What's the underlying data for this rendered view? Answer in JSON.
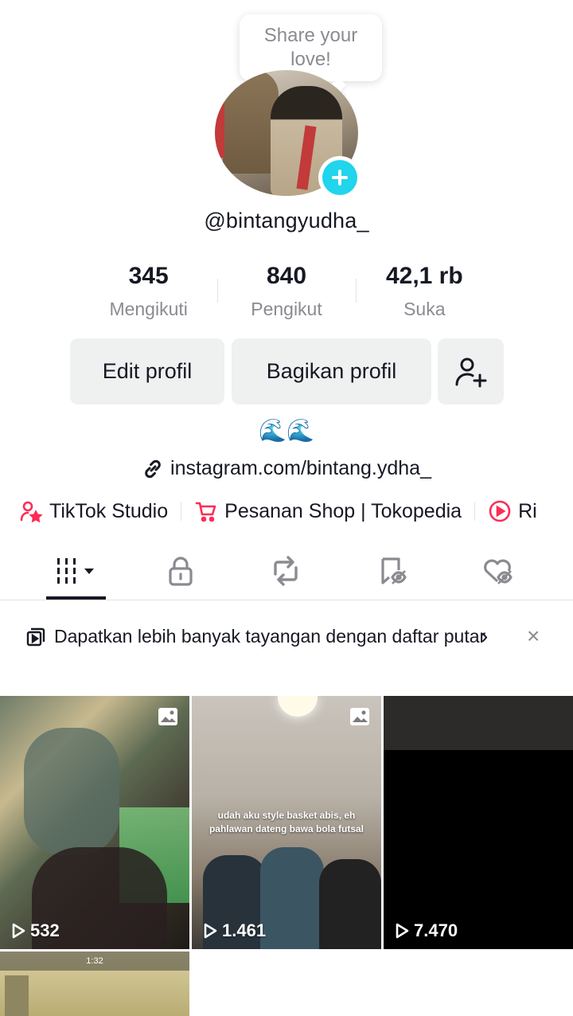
{
  "profile": {
    "bubble_text": "Share your love!",
    "username": "@bintangyudha_",
    "bio": "🌊🌊",
    "link": "instagram.com/bintang.ydha_"
  },
  "stats": [
    {
      "value": "345",
      "label": "Mengikuti"
    },
    {
      "value": "840",
      "label": "Pengikut"
    },
    {
      "value": "42,1 rb",
      "label": "Suka"
    }
  ],
  "buttons": {
    "edit": "Edit profil",
    "share": "Bagikan profil"
  },
  "shortcuts": [
    {
      "label": "TikTok Studio",
      "icon": "person-star-icon"
    },
    {
      "label": "Pesanan Shop | Tokopedia",
      "icon": "cart-icon"
    },
    {
      "label": "Ri",
      "icon": "play-circle-icon"
    }
  ],
  "tabs": [
    {
      "name": "videos",
      "icon": "grid-icon",
      "active": true
    },
    {
      "name": "private",
      "icon": "lock-icon"
    },
    {
      "name": "reposts",
      "icon": "repost-icon"
    },
    {
      "name": "favorites",
      "icon": "bookmark-icon"
    },
    {
      "name": "liked",
      "icon": "heart-hidden-icon"
    }
  ],
  "banner": {
    "text": "Dapatkan lebih banyak tayangan dengan daftar putar",
    "chevron": "›",
    "close": "×"
  },
  "videos": [
    {
      "views": "532",
      "type": "photo"
    },
    {
      "views": "1.461",
      "type": "photo",
      "caption": "udah aku style basket abis, eh pahlawan dateng bawa bola futsal"
    },
    {
      "views": "7.470",
      "type": "video"
    },
    {
      "views": "",
      "type": "video",
      "hud_time": "1:32"
    }
  ],
  "colors": {
    "accent_cyan": "#20d5ec",
    "brand_red": "#fe2c55",
    "text_primary": "#161823",
    "text_secondary": "#8a8b91",
    "button_bg": "#eff0f0"
  }
}
